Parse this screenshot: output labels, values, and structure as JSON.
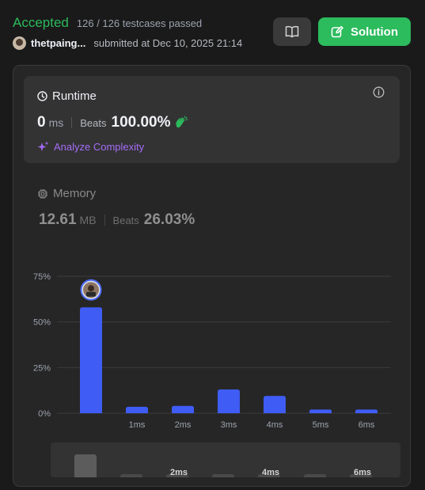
{
  "header": {
    "status": "Accepted",
    "testcases": "126 / 126 testcases passed",
    "username": "thetpaing...",
    "submitted": "submitted at Dec 10, 2025 21:14",
    "solution_label": "Solution",
    "colors": {
      "accepted": "#2cbb5d",
      "solution_button": "#2cbb5d"
    }
  },
  "runtime": {
    "title": "Runtime",
    "value": "0",
    "unit": "ms",
    "beats_label": "Beats",
    "beats_pct": "100.00%",
    "analyze_label": "Analyze Complexity",
    "icons": [
      "clock-icon",
      "info-icon",
      "clap-icon",
      "sparkle-icon"
    ]
  },
  "memory": {
    "title": "Memory",
    "value": "12.61",
    "unit": "MB",
    "beats_label": "Beats",
    "beats_pct": "26.03%",
    "icons": [
      "chip-icon"
    ]
  },
  "chart_data": {
    "type": "bar",
    "y_ticks": [
      "75%",
      "50%",
      "25%",
      "0%"
    ],
    "ylim": [
      0,
      75
    ],
    "grid": true,
    "bars": [
      58,
      3.5,
      4,
      13,
      9.5,
      2,
      2
    ],
    "x_labels": [
      "",
      "1ms",
      "2ms",
      "3ms",
      "4ms",
      "5ms",
      "6ms"
    ],
    "highlight_index": 0,
    "bar_color": "#3f5cf5",
    "marker": "avatar",
    "minimap": {
      "bar_levels": [
        "tall",
        "low",
        "low",
        "low",
        "low",
        "low",
        "low"
      ],
      "labels": [
        "",
        "",
        "2ms",
        "",
        "4ms",
        "",
        "6ms"
      ]
    }
  }
}
